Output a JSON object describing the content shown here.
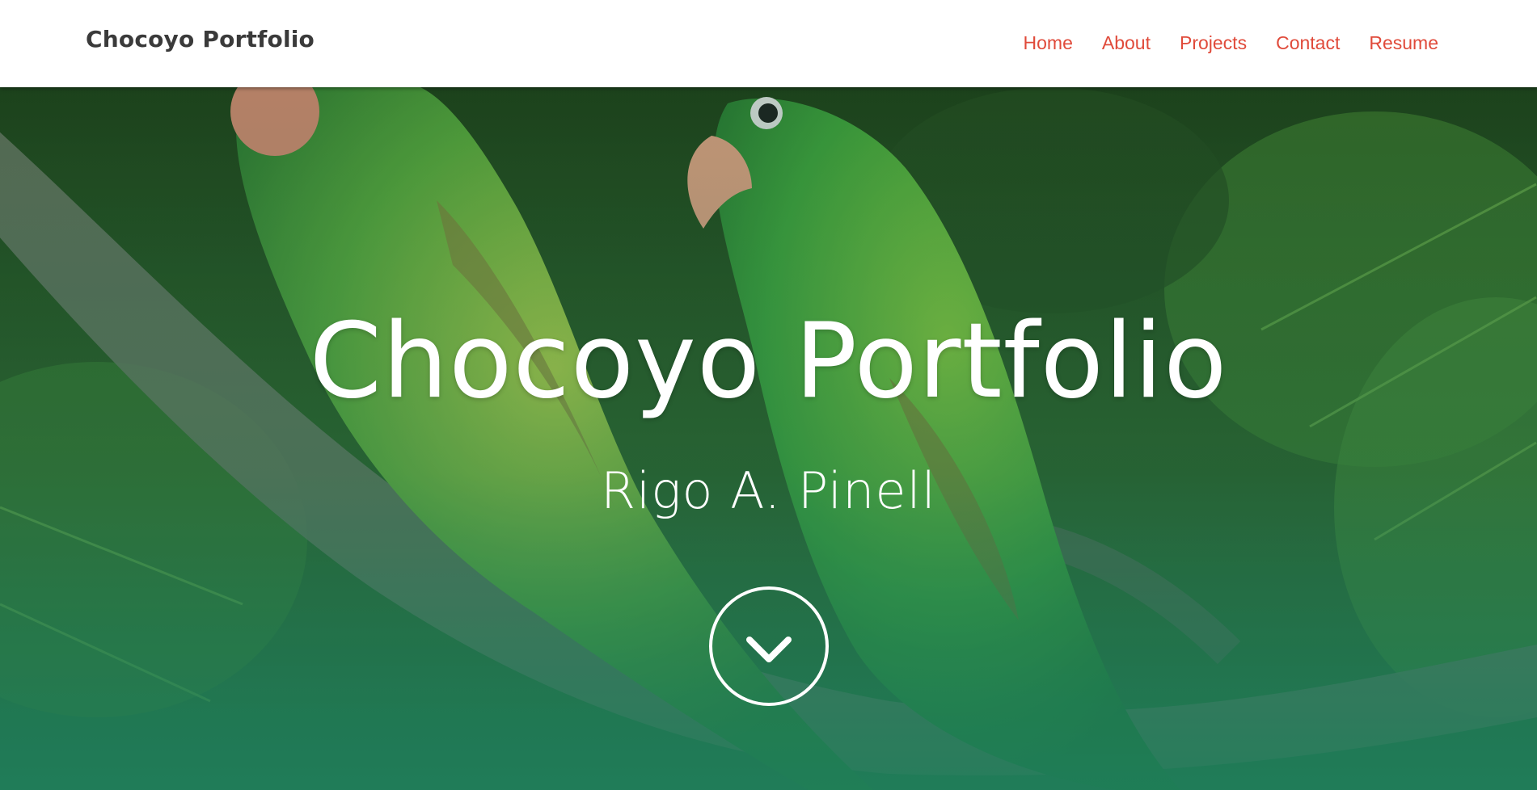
{
  "nav": {
    "brand": "Chocoyo Portfolio",
    "links": [
      "Home",
      "About",
      "Projects",
      "Contact",
      "Resume"
    ]
  },
  "hero": {
    "title": "Chocoyo Portfolio",
    "subtitle": "Rigo A. Pinell",
    "scroll_icon": "chevron-down-circle-icon",
    "background": "parrots-on-branch"
  },
  "colors": {
    "accent": "#e04a3a",
    "brand_text": "#3a3a3a",
    "hero_overlay": "#1f8a68"
  }
}
